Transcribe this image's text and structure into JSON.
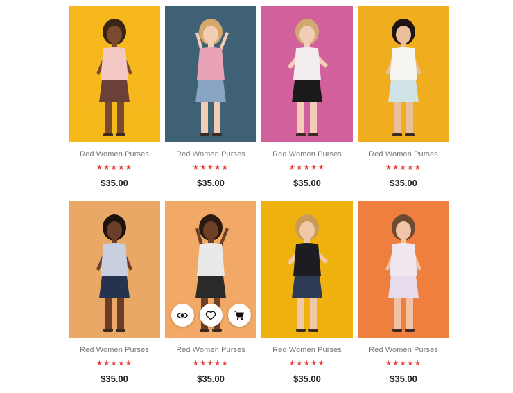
{
  "products": [
    {
      "name": "Red Women Purses",
      "price": "$35.00",
      "rating": 5,
      "bg": "#f6b81c",
      "skin": "#7a4a2e",
      "top": "#f3c7c2",
      "bottom": "#6b4038",
      "hair": "#3a2414"
    },
    {
      "name": "Red Women Purses",
      "price": "$35.00",
      "rating": 5,
      "bg": "#3f6176",
      "skin": "#f1cdb6",
      "top": "#e9a3b6",
      "bottom": "#8aa4c3",
      "hair": "#d5a86a"
    },
    {
      "name": "Red Women Purses",
      "price": "$35.00",
      "rating": 5,
      "bg": "#d2609c",
      "skin": "#f4cdb8",
      "top": "#f2ecec",
      "bottom": "#1a1a1a",
      "hair": "#d1a870"
    },
    {
      "name": "Red Women Purses",
      "price": "$35.00",
      "rating": 5,
      "bg": "#f0ad1e",
      "skin": "#e9bf9c",
      "top": "#f6f4ef",
      "bottom": "#cfe2e6",
      "hair": "#1e1410"
    },
    {
      "name": "Red Women Purses",
      "price": "$35.00",
      "rating": 5,
      "bg": "#e9a866",
      "skin": "#6b3f27",
      "top": "#c8d0e0",
      "bottom": "#26324e",
      "hair": "#1b120c"
    },
    {
      "name": "Red Women Purses",
      "price": "$35.00",
      "rating": 5,
      "bg": "#f2a866",
      "skin": "#6e4026",
      "top": "#e9e9e9",
      "bottom": "#2a2a2a",
      "hair": "#2b1a10"
    },
    {
      "name": "Red Women Purses",
      "price": "$35.00",
      "rating": 5,
      "bg": "#eeb10e",
      "skin": "#f0c8a8",
      "top": "#1c1c22",
      "bottom": "#2d3a56",
      "hair": "#c99a58"
    },
    {
      "name": "Red Women Purses",
      "price": "$35.00",
      "rating": 5,
      "bg": "#ef7f3e",
      "skin": "#f2c3a6",
      "top": "#f0e6f0",
      "bottom": "#e6dcee",
      "hair": "#6a4a30"
    }
  ],
  "hover_card_index": 5,
  "hover_actions": [
    {
      "name": "quick-view-button",
      "icon": "eye-icon"
    },
    {
      "name": "wishlist-button",
      "icon": "heart-icon"
    },
    {
      "name": "add-to-cart-button",
      "icon": "cart-icon"
    }
  ],
  "star_color": "#e53935"
}
